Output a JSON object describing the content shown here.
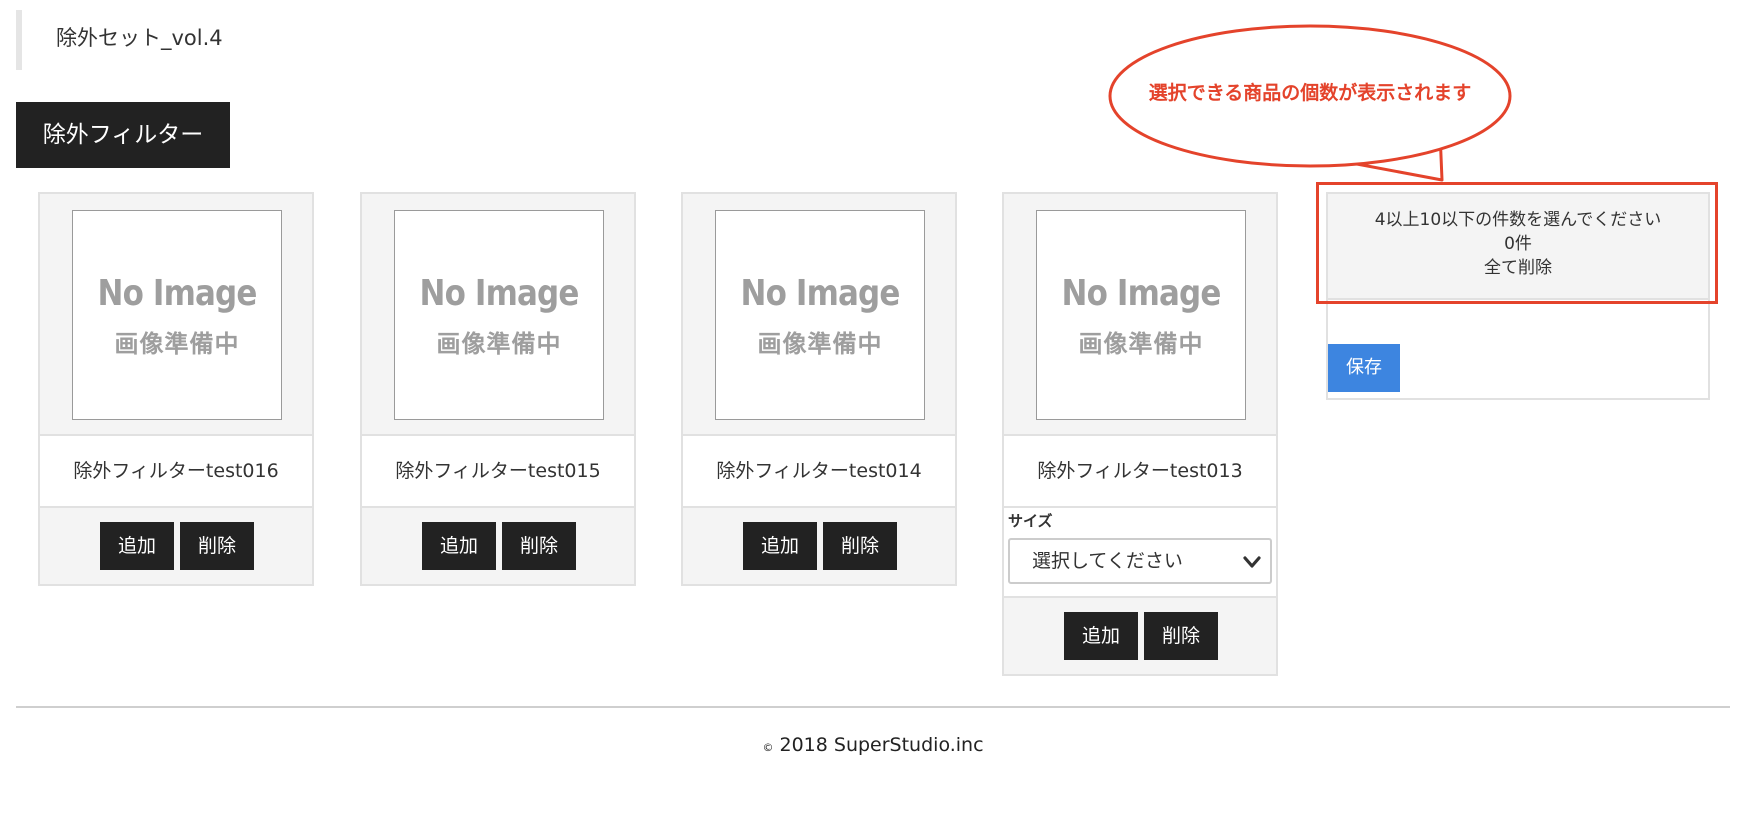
{
  "page": {
    "title": "除外セット_vol.4"
  },
  "tab": {
    "label": "除外フィルター"
  },
  "placeholder_image": {
    "line1": "No Image",
    "line2": "画像準備中"
  },
  "products": [
    {
      "name": "除外フィルターtest016",
      "add_label": "追加",
      "delete_label": "削除"
    },
    {
      "name": "除外フィルターtest015",
      "add_label": "追加",
      "delete_label": "削除"
    },
    {
      "name": "除外フィルターtest014",
      "add_label": "追加",
      "delete_label": "削除"
    },
    {
      "name": "除外フィルターtest013",
      "add_label": "追加",
      "delete_label": "削除",
      "size_label": "サイズ",
      "size_select_value": "選択してください"
    }
  ],
  "summary": {
    "instruction": "4以上10以下の件数を選んでください",
    "count": "0件",
    "delete_all": "全て削除",
    "save_label": "保存"
  },
  "annotation": {
    "callout_text": "選択できる商品の個数が表示されます",
    "color": "#e4432b"
  },
  "footer": {
    "copyright_symbol": "©",
    "text": " 2018 SuperStudio.inc"
  },
  "colors": {
    "dark_button": "#222222",
    "save_button": "#3d85e0",
    "card_bg": "#f4f4f4"
  }
}
